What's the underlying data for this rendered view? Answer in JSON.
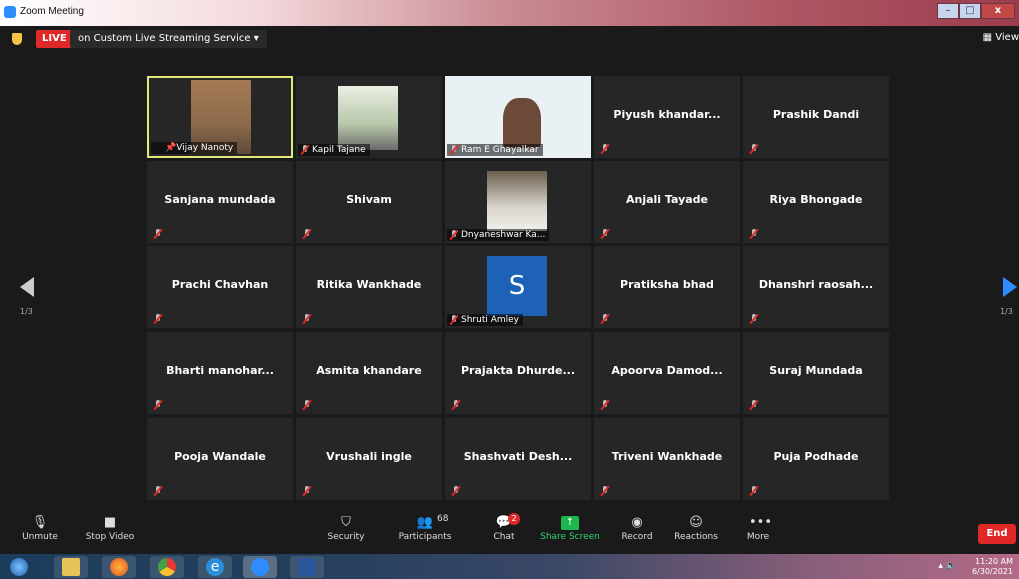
{
  "window": {
    "title": "Zoom Meeting"
  },
  "topbar": {
    "live_label": "LIVE",
    "stream_label": "on Custom Live Streaming Service",
    "stream_caret": "▾",
    "view_label": "View"
  },
  "tiles": [
    {
      "name": "Vijay Nanoty",
      "type": "video"
    },
    {
      "name": "Kapil Tajane",
      "type": "video"
    },
    {
      "name": "Ram E Ghayalkar",
      "type": "video"
    },
    {
      "name": "Piyush  khandar...",
      "type": "name"
    },
    {
      "name": "Prashik Dandi",
      "type": "name"
    },
    {
      "name": "Sanjana mundada",
      "type": "name"
    },
    {
      "name": "Shivam",
      "type": "name"
    },
    {
      "name": "Dnyaneshwar Ka...",
      "type": "video"
    },
    {
      "name": "Anjali Tayade",
      "type": "name"
    },
    {
      "name": "Riya Bhongade",
      "type": "name"
    },
    {
      "name": "Prachi Chavhan",
      "type": "name"
    },
    {
      "name": "Ritika Wankhade",
      "type": "name"
    },
    {
      "name": "Shruti Amley",
      "type": "avatar",
      "initial": "S"
    },
    {
      "name": "Pratiksha bhad",
      "type": "name"
    },
    {
      "name": "Dhanshri  raosah...",
      "type": "name"
    },
    {
      "name": "Bharti  manohar...",
      "type": "name"
    },
    {
      "name": "Asmita khandare",
      "type": "name"
    },
    {
      "name": "Prajakta  Dhurde...",
      "type": "name"
    },
    {
      "name": "Apoorva  Damod...",
      "type": "name"
    },
    {
      "name": "Suraj Mundada",
      "type": "name"
    },
    {
      "name": "Pooja Wandale",
      "type": "name"
    },
    {
      "name": "Vrushali ingle",
      "type": "name"
    },
    {
      "name": "Shashvati  Desh...",
      "type": "name"
    },
    {
      "name": "Triveni Wankhade",
      "type": "name"
    },
    {
      "name": "Puja Podhade",
      "type": "name"
    }
  ],
  "pager": {
    "left": "1/3",
    "right": "1/3"
  },
  "controls": {
    "unmute": "Unmute",
    "stop_video": "Stop Video",
    "security": "Security",
    "participants": "Participants",
    "participants_count": "68",
    "chat": "Chat",
    "chat_badge": "2",
    "share_screen": "Share Screen",
    "record": "Record",
    "reactions": "Reactions",
    "more": "More",
    "more_dots": "•••",
    "end": "End"
  },
  "taskbar": {
    "time": "11:20 AM",
    "date": "6/30/2021",
    "tray": "▴ 🔈"
  },
  "colors": {
    "accent": "#2d8cff",
    "danger": "#e02828",
    "share": "#1db74f",
    "active_border": "#e5e77a"
  }
}
